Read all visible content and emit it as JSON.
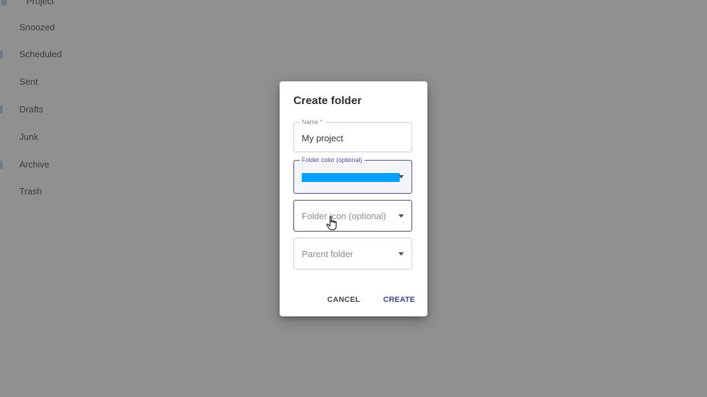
{
  "sidebar": {
    "items": [
      {
        "label": "Project"
      },
      {
        "label": "Snoozed"
      },
      {
        "label": "Scheduled"
      },
      {
        "label": "Sent"
      },
      {
        "label": "Drafts"
      },
      {
        "label": "Junk"
      },
      {
        "label": "Archive"
      },
      {
        "label": "Trash"
      }
    ]
  },
  "dialog": {
    "title": "Create folder",
    "name_field": {
      "label": "Name *",
      "value": "My project"
    },
    "color_field": {
      "label": "Folder color (optional)",
      "selected_color": "#00a0ff"
    },
    "icon_field": {
      "placeholder": "Folder icon (optional)"
    },
    "parent_field": {
      "placeholder": "Parent folder"
    },
    "cancel_label": "CANCEL",
    "create_label": "CREATE"
  },
  "colors": {
    "overlay": "#8f9090",
    "accent": "#3d4391",
    "swatch": "#00a0ff"
  }
}
